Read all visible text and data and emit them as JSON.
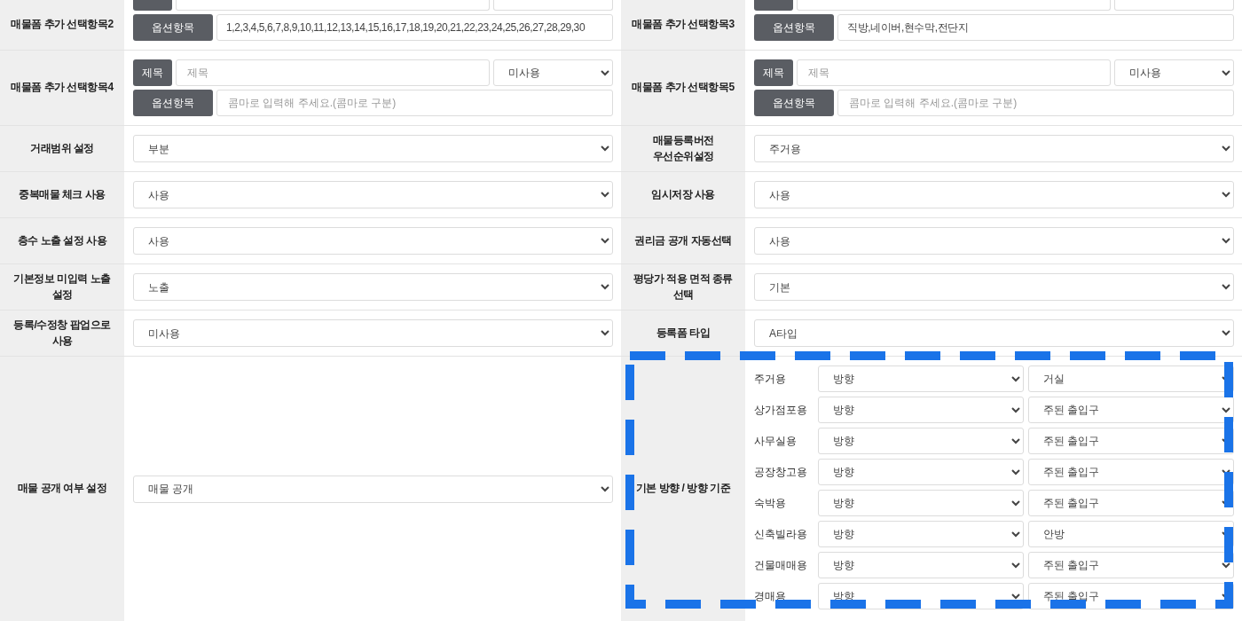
{
  "rows": [
    {
      "left": {
        "label": "매물폼 추가 선택항목2",
        "kind": "options",
        "title_cut": true,
        "options_label": "옵션항목",
        "options_value": "1,2,3,4,5,6,7,8,9,10,11,12,13,14,15,16,17,18,19,20,21,22,23,24,25,26,27,28,29,30"
      },
      "right": {
        "label": "매물폼 추가 선택항목3",
        "kind": "options",
        "title_cut": true,
        "options_label": "옵션항목",
        "options_value": "직방,네이버,현수막,전단지"
      }
    },
    {
      "left": {
        "label": "매물폼 추가 선택항목4",
        "kind": "options",
        "title_label": "제목",
        "title_placeholder": "제목",
        "select": "미사용",
        "options_label": "옵션항목",
        "options_placeholder": "콤마로 입력해 주세요.(콤마로 구분)"
      },
      "right": {
        "label": "매물폼 추가 선택항목5",
        "kind": "options",
        "title_label": "제목",
        "title_placeholder": "제목",
        "select": "미사용",
        "options_label": "옵션항목",
        "options_placeholder": "콤마로 입력해 주세요.(콤마로 구분)"
      }
    },
    {
      "left": {
        "label": "거래범위 설정",
        "kind": "select",
        "select": "부분"
      },
      "right": {
        "label": "매물등록버전\n우선순위설정",
        "kind": "select",
        "select": "주거용"
      }
    },
    {
      "left": {
        "label": "중복매물 체크 사용",
        "kind": "select",
        "select": "사용"
      },
      "right": {
        "label": "임시저장 사용",
        "kind": "select",
        "select": "사용"
      }
    },
    {
      "left": {
        "label": "층수 노출 설정 사용",
        "kind": "select",
        "select": "사용"
      },
      "right": {
        "label": "권리금 공개 자동선택",
        "kind": "select",
        "select": "사용"
      }
    },
    {
      "left": {
        "label": "기본정보 미입력 노출 설정",
        "kind": "select",
        "select": "노출"
      },
      "right": {
        "label": "평당가 적용 면적 종류 선택",
        "kind": "select",
        "select": "기본"
      }
    },
    {
      "left": {
        "label": "등록/수정창 팝업으로 사용",
        "kind": "select",
        "select": "미사용"
      },
      "right": {
        "label": "등록폼 타입",
        "kind": "select",
        "select": "A타입"
      }
    },
    {
      "left": {
        "label": "매물 공개 여부 설정",
        "kind": "select",
        "select": "매물 공개"
      },
      "right": {
        "label": "기본 방향 / 방향 기준",
        "kind": "directions",
        "highlighted": true,
        "items": [
          {
            "name": "주거용",
            "direction": "방향",
            "basis": "거실"
          },
          {
            "name": "상가점포용",
            "direction": "방향",
            "basis": "주된 출입구"
          },
          {
            "name": "사무실용",
            "direction": "방향",
            "basis": "주된 출입구"
          },
          {
            "name": "공장창고용",
            "direction": "방향",
            "basis": "주된 출입구"
          },
          {
            "name": "숙박용",
            "direction": "방향",
            "basis": "주된 출입구"
          },
          {
            "name": "신축빌라용",
            "direction": "방향",
            "basis": "안방"
          },
          {
            "name": "건물매매용",
            "direction": "방향",
            "basis": "주된 출입구"
          },
          {
            "name": "경매용",
            "direction": "방향",
            "basis": "주된 출입구"
          }
        ]
      }
    }
  ]
}
